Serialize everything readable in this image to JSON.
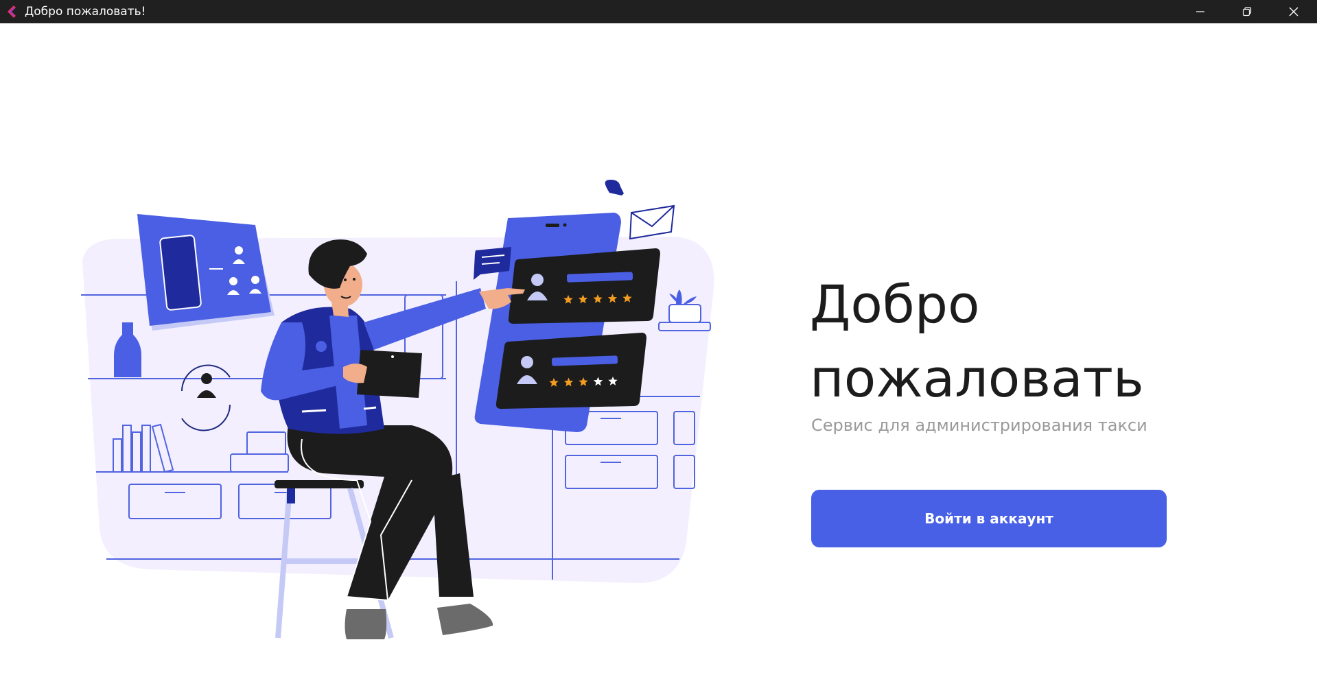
{
  "window": {
    "title": "Добро пожаловать!",
    "icons": [
      "app-logo-icon",
      "minimize-icon",
      "restore-icon",
      "close-icon"
    ]
  },
  "welcome": {
    "heading_line1": "Добро",
    "heading_line2": "пожаловать",
    "subtitle": "Сервис для администрирования такси",
    "login_button": "Войти в аккаунт"
  },
  "illustration": {
    "rating_cards": [
      {
        "filled_stars": 5,
        "total_stars": 5
      },
      {
        "filled_stars": 3,
        "total_stars": 5
      }
    ]
  },
  "colors": {
    "titlebar": "#202020",
    "accent": "#4860e6",
    "illustration_blue": "#4a5fe3",
    "illustration_bg": "#f3effe",
    "star": "#f39c1f"
  }
}
